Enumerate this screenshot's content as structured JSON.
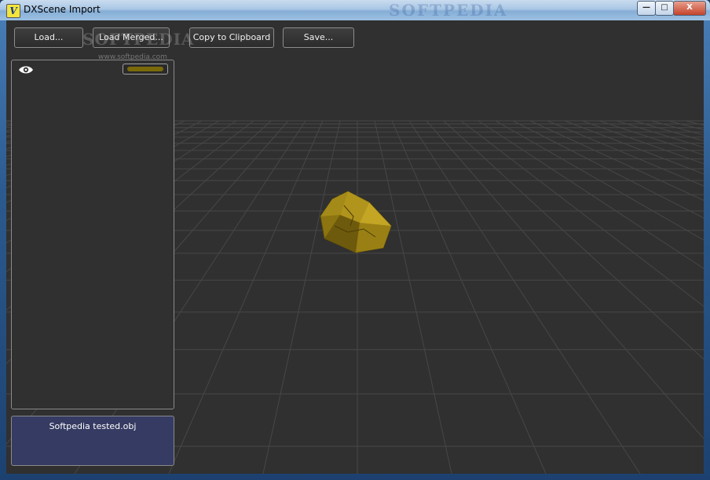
{
  "window": {
    "title": "DXScene Import",
    "app_icon_glyph": "V",
    "title_watermark": "SOFTPEDIA",
    "controls": {
      "minimize": "—",
      "maximize": "□",
      "close": "X"
    }
  },
  "toolbar": {
    "load_label": "Load...",
    "load_merged_label": "Load Merged...",
    "copy_label": "Copy to Clipboard",
    "save_label": "Save..."
  },
  "watermark": {
    "text": "SOFTPEDIA",
    "url": "www.softpedia.com"
  },
  "layers_panel": {
    "visibility_icon": "eye-icon",
    "object_color": "#7a6a0a"
  },
  "file_panel": {
    "file_name": "Softpedia tested.obj"
  },
  "colors": {
    "viewport_bg": "#303030",
    "grid_line": "#474747",
    "model_gold": "#8c7410",
    "file_panel_bg": "#353b62"
  }
}
